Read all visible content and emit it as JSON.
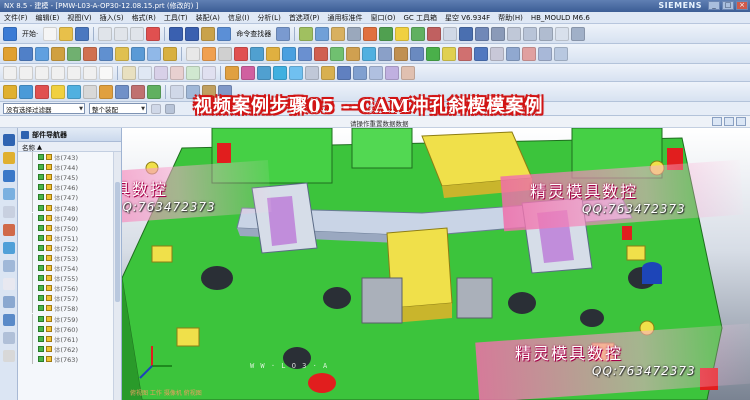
{
  "window": {
    "title": "NX 8.5 - 建模 - [PMW-L03-A-OP30-12.08.15.prt  (修改的) ]",
    "brand": "SIEMENS",
    "minimize": "_",
    "maximize": "□",
    "close": "×"
  },
  "menu": [
    "文件(F)",
    "编辑(E)",
    "视图(V)",
    "插入(S)",
    "格式(R)",
    "工具(T)",
    "装配(A)",
    "信息(I)",
    "分析(L)",
    "首选项(P)",
    "通用标准件",
    "窗口(O)",
    "GC 工具箱",
    "星空 V6.934F",
    "帮助(H)",
    "HB_MOULD M6.6"
  ],
  "toolbar": {
    "start_label": "开始·",
    "command_finder_label": "命令查找器"
  },
  "selection_bar": {
    "filter": "没有选择过滤器",
    "scope": "整个装配"
  },
  "cue_line": "请操作重置数据数据",
  "caption": "视频案例步骤05 --CAM冲孔斜楔模案例",
  "navigator": {
    "title": "部件导航器",
    "column_name": "名称",
    "body_label": "体",
    "rows": [
      "(743)",
      "(744)",
      "(745)",
      "(746)",
      "(747)",
      "(748)",
      "(749)",
      "(750)",
      "(751)",
      "(752)",
      "(753)",
      "(754)",
      "(755)",
      "(756)",
      "(757)",
      "(758)",
      "(759)",
      "(760)",
      "(761)",
      "(762)",
      "(763)"
    ]
  },
  "watermarks": [
    {
      "title": "精灵模具数控",
      "qq": "QQ:763472373"
    },
    {
      "title": "精灵模具数控",
      "qq": "QQ:763472373"
    },
    {
      "title": "精灵模具数控",
      "qq": "QQ:763472373"
    }
  ],
  "bottom_watermark": "W W · L O 3 · A",
  "status_hint": "俯视图 工作 摄像机 俯视图",
  "colors": {
    "die_base": "#3cc43c",
    "insert_yellow": "#f0e04a",
    "accent_red": "#e11e1e",
    "part_silver": "#c9d4e6"
  }
}
